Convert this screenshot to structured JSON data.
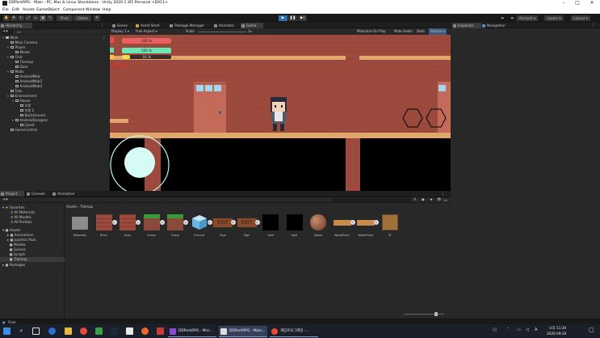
{
  "window": {
    "title": "DDParkRPG - Main - PC, Mac & Linux Standalone - Unity 2020.1.3f1 Personal <DX11>",
    "controls": [
      "–",
      "□",
      "✕"
    ]
  },
  "menu": [
    "File",
    "Edit",
    "Assets",
    "GameObject",
    "Component",
    "Window",
    "Help"
  ],
  "toolbar": {
    "pivot": "Pivot",
    "global": "Global",
    "account": "Account ▾",
    "layers": "Layers ▾",
    "layout": "Layout ▾"
  },
  "scene_tabs": [
    {
      "label": "Scene",
      "color": "#8a8a8a"
    },
    {
      "label": "Asset Store",
      "color": "#d6a33a"
    },
    {
      "label": "Package Manager",
      "color": "#8a8a8a"
    },
    {
      "label": "Animator",
      "color": "#8a8a8a"
    },
    {
      "label": "Game",
      "color": "#8a8a8a"
    }
  ],
  "game_bar": {
    "display": "Display 1 ▾",
    "aspect": "Free Aspect ▾",
    "scale_label": "Scale",
    "scale_value": "1x",
    "maximize": "Maximize On Play",
    "mute": "Mute Audio",
    "stats": "Stats",
    "gizmos": "Gizmos ▾"
  },
  "hierarchy": {
    "tab": "Hierarchy",
    "search_placeholder": "All",
    "rows": [
      {
        "label": "Main",
        "indent": 0,
        "arrow": "▾",
        "kind": "scene"
      },
      {
        "label": "Main Camera",
        "indent": 1,
        "arrow": "",
        "kind": "obj"
      },
      {
        "label": "Player",
        "indent": 1,
        "arrow": "▾",
        "kind": "obj"
      },
      {
        "label": "Melee",
        "indent": 2,
        "arrow": "",
        "kind": "obj"
      },
      {
        "label": "Grid",
        "indent": 1,
        "arrow": "▾",
        "kind": "obj"
      },
      {
        "label": "Tilemap",
        "indent": 2,
        "arrow": "",
        "kind": "obj"
      },
      {
        "label": "Door",
        "indent": 2,
        "arrow": "",
        "kind": "obj"
      },
      {
        "label": "Mobs",
        "indent": 1,
        "arrow": "▾",
        "kind": "obj"
      },
      {
        "label": "AndroidMob",
        "indent": 2,
        "arrow": "",
        "kind": "obj"
      },
      {
        "label": "AndroidMob2",
        "indent": 2,
        "arrow": "",
        "kind": "obj"
      },
      {
        "label": "AndroidMob3",
        "indent": 2,
        "arrow": "",
        "kind": "obj"
      },
      {
        "label": "Task",
        "indent": 1,
        "arrow": "",
        "kind": "obj"
      },
      {
        "label": "Environment",
        "indent": 1,
        "arrow": "▾",
        "kind": "obj"
      },
      {
        "label": "House",
        "indent": 2,
        "arrow": "▾",
        "kind": "obj"
      },
      {
        "label": "지붕",
        "indent": 3,
        "arrow": "",
        "kind": "obj"
      },
      {
        "label": "지붕 2",
        "indent": 3,
        "arrow": "",
        "kind": "obj"
      },
      {
        "label": "BackGround",
        "indent": 3,
        "arrow": "",
        "kind": "obj"
      },
      {
        "label": "AndroidDungeon",
        "indent": 2,
        "arrow": "▾",
        "kind": "obj"
      },
      {
        "label": "Guest",
        "indent": 3,
        "arrow": "",
        "kind": "obj"
      },
      {
        "label": "GameControl",
        "indent": 1,
        "arrow": "",
        "kind": "obj"
      }
    ]
  },
  "inspector": {
    "tab": "Inspector",
    "nav_tab": "Navigation"
  },
  "hud": {
    "hp_text": "100 %",
    "mp_text": "100 %",
    "xp_text": "16 %",
    "xp_fraction": 0.16,
    "level_text": "0 LV. 1"
  },
  "bottom_tabs": [
    {
      "label": "Project"
    },
    {
      "label": "Console"
    },
    {
      "label": "Animation"
    }
  ],
  "project": {
    "favorites_label": "Favorites",
    "favorites": [
      "All Materials",
      "All Models",
      "All Prefabs"
    ],
    "assets_label": "Assets",
    "folders": [
      "Animations",
      "Joystick Pack",
      "Models",
      "Scenes",
      "Scripts",
      "Tilemap"
    ],
    "packages_label": "Packages",
    "breadcrumb": [
      "Assets",
      "Tilemap"
    ],
    "count": "14",
    "items": [
      {
        "name": "Materials",
        "kind": "folder"
      },
      {
        "name": "Brick",
        "kind": "brick"
      },
      {
        "name": "Door",
        "kind": "brick"
      },
      {
        "name": "Grass",
        "kind": "grass"
      },
      {
        "name": "Grass",
        "kind": "grass"
      },
      {
        "name": "Ground",
        "kind": "cube"
      },
      {
        "name": "Sign",
        "kind": "exit"
      },
      {
        "name": "Sign",
        "kind": "exit"
      },
      {
        "name": "Void",
        "kind": "void"
      },
      {
        "name": "Void",
        "kind": "void"
      },
      {
        "name": "Wood",
        "kind": "sphere"
      },
      {
        "name": "WoodFloor",
        "kind": "plank"
      },
      {
        "name": "WoodFloor",
        "kind": "plank"
      },
      {
        "name": "여",
        "kind": "crate"
      }
    ]
  },
  "status": {
    "text": "Floor"
  },
  "taskbar": {
    "tasks": [
      "DDParkRPG - Micr...",
      "DDParkRPG - Main...",
      "개임프로그래밍 -..."
    ],
    "lang": "A",
    "time": "오후 11:30",
    "date": "2020-09-20"
  }
}
